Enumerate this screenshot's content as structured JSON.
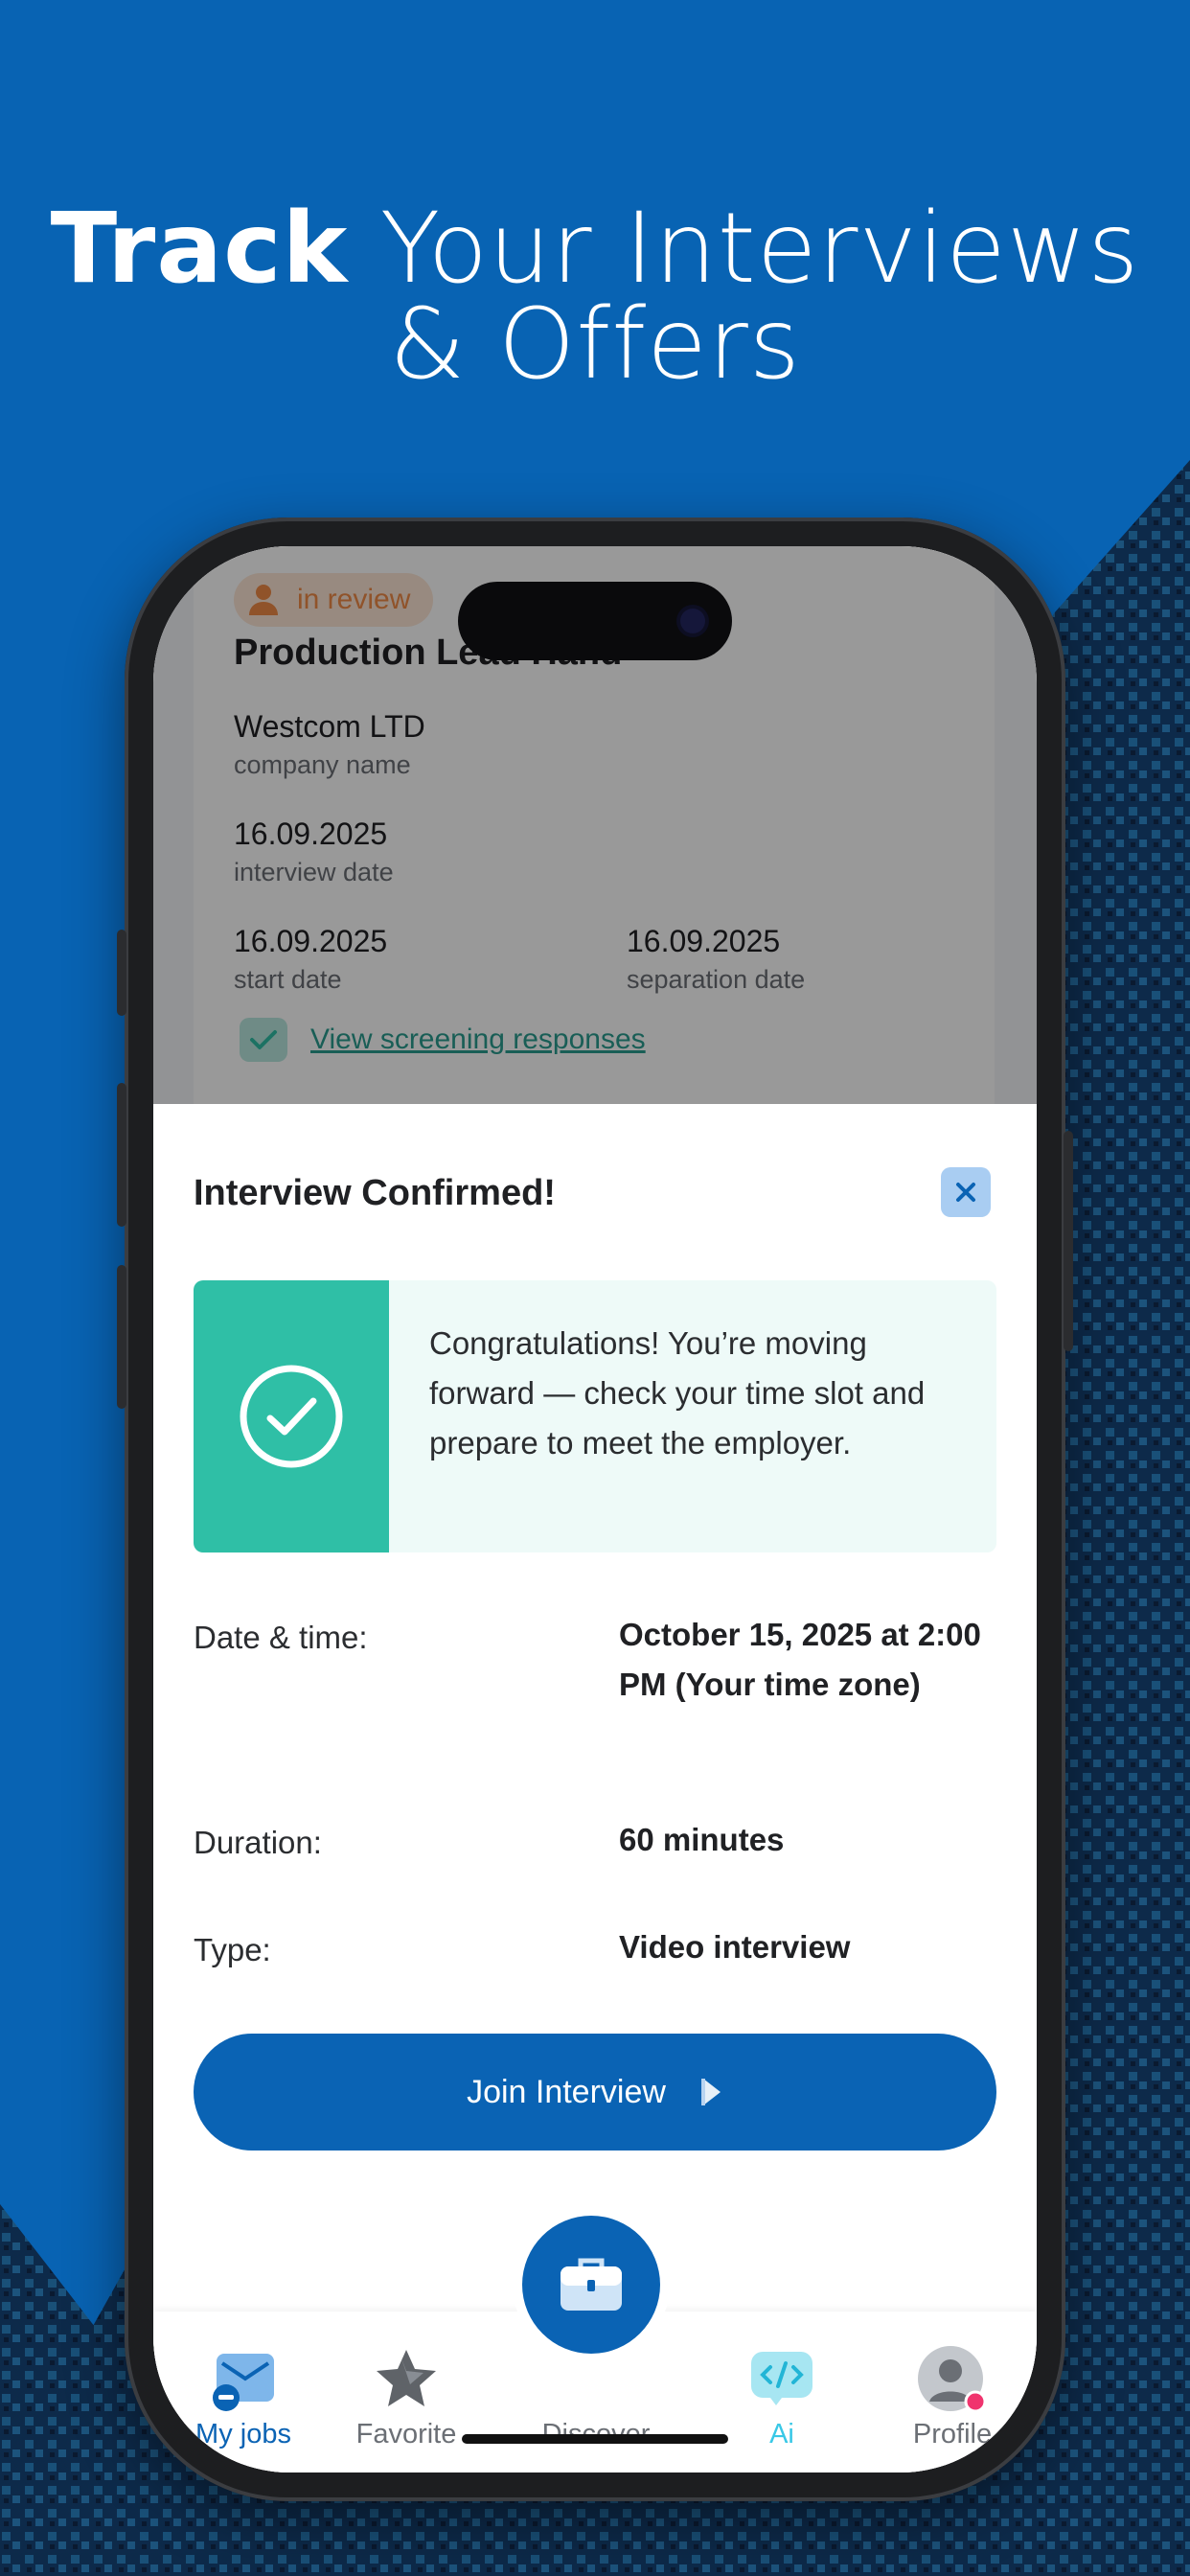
{
  "hero": {
    "bold": "Track",
    "line1_rest": " Your Interviews",
    "line2": "& Offers"
  },
  "job": {
    "status": "in review",
    "title": "Production Lead Hand",
    "company": "Westcom LTD",
    "company_label": "company name",
    "interview_date": "16.09.2025",
    "interview_date_label": "interview date",
    "start_date": "16.09.2025",
    "start_date_label": "start date",
    "separation_date": "16.09.2025",
    "separation_date_label": "separation date",
    "screening_link": "View screening responses"
  },
  "modal": {
    "title": "Interview Confirmed!",
    "message": "Congratulations! You’re moving forward — check your time slot and prepare to meet the employer.",
    "date_label": "Date & time:",
    "date_value": "October 15, 2025 at 2:00 PM (Your time zone)",
    "duration_label": "Duration:",
    "duration_value": "60 minutes",
    "type_label": "Type:",
    "type_value": "Video interview",
    "join_label": "Join Interview"
  },
  "tabs": {
    "my_jobs": "My jobs",
    "favorite": "Favorite",
    "discover": "Discover",
    "ai": "Ai",
    "profile": "Profile"
  },
  "colors": {
    "brand": "#0a63b4",
    "success": "#2fbfa6",
    "status_review": "#f08a46",
    "notification": "#f0346e"
  }
}
